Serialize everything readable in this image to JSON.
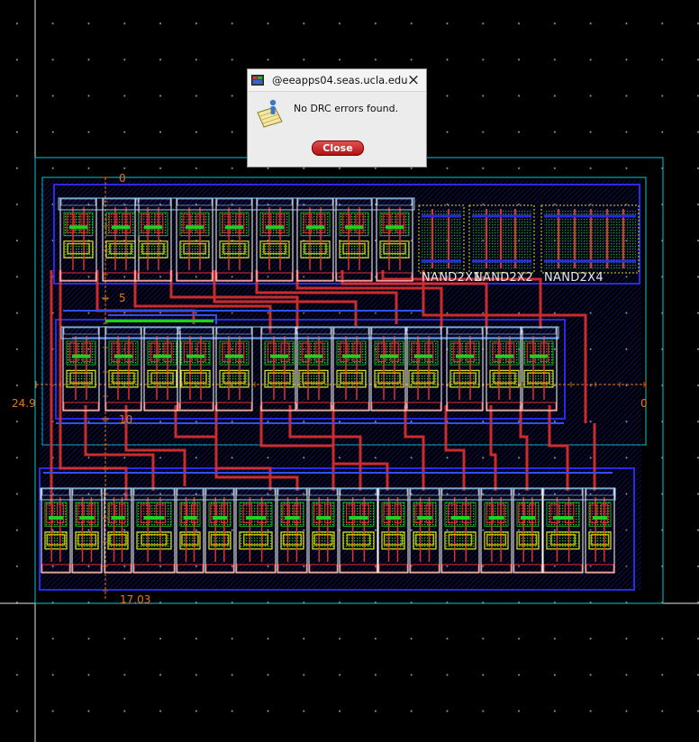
{
  "dialog": {
    "title": "@eeapps04.seas.ucla.edu",
    "message": "No DRC errors found.",
    "close_button_label": "Close",
    "close_glyph": "×",
    "app_icon": "app-window-icon",
    "message_icon": "note-info-icon"
  },
  "rulers": {
    "vertical": [
      "0",
      "5",
      "10"
    ],
    "left_value": "24.9",
    "right_value": "0",
    "bottom_value": "17.03"
  },
  "cells": [
    "NAND2X1",
    "NAND2X2",
    "NAND2X4"
  ],
  "colors": {
    "background": "#000000",
    "grid_dots": "#9a9a9a",
    "ruler": "#e07820",
    "boundary": "#00c8d8",
    "metal1": "#2a2ae6",
    "metal2": "#e03030",
    "poly": "#ff3030",
    "diffusion": "#20e020",
    "well": "#e0e020",
    "cell_outline": "#ffffff"
  }
}
